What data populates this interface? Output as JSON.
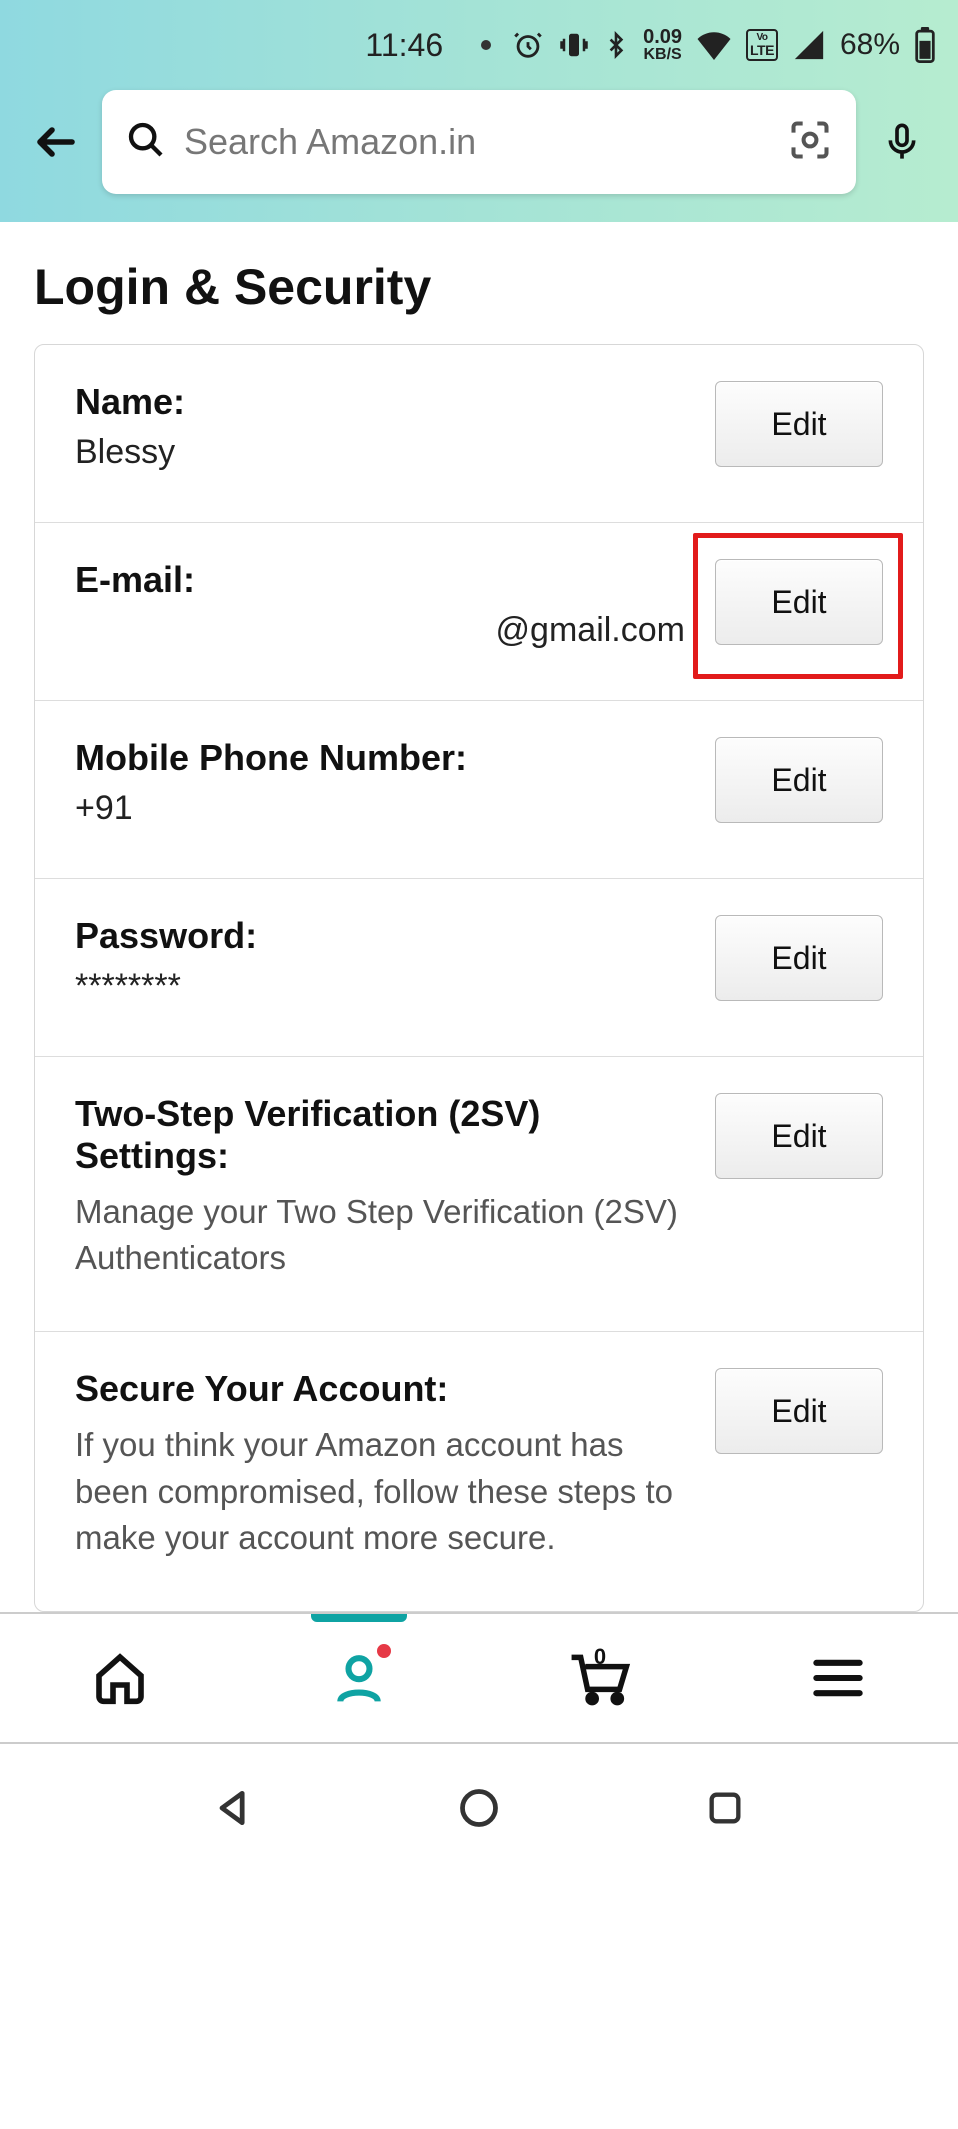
{
  "status": {
    "time": "11:46",
    "net_rate_top": "0.09",
    "net_rate_bottom": "KB/S",
    "lte_top": "Vo",
    "lte_bottom": "LTE",
    "battery_pct": "68%"
  },
  "search": {
    "placeholder": "Search Amazon.in"
  },
  "page": {
    "title": "Login & Security"
  },
  "rows": {
    "name": {
      "label": "Name:",
      "value": "Blessy",
      "button": "Edit"
    },
    "email": {
      "label": "E-mail:",
      "value": "@gmail.com",
      "button": "Edit"
    },
    "mobile": {
      "label": "Mobile Phone Number:",
      "value": "+91",
      "button": "Edit"
    },
    "password": {
      "label": "Password:",
      "value": "********",
      "button": "Edit"
    },
    "twosv": {
      "label": "Two-Step Verification (2SV) Settings:",
      "desc": "Manage your Two Step Verification (2SV) Authenticators",
      "button": "Edit"
    },
    "secure": {
      "label": "Secure Your Account:",
      "desc": "If you think your Amazon account has been compromised, follow these steps to make your account more secure.",
      "button": "Edit"
    }
  },
  "nav": {
    "cart_count": "0"
  }
}
